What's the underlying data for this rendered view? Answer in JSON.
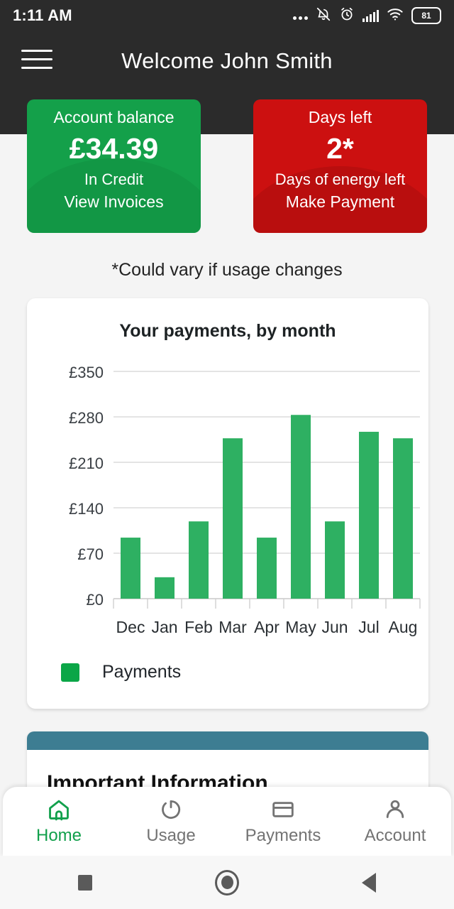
{
  "status_bar": {
    "time": "1:11 AM",
    "battery": "81",
    "icons": [
      "more-dots-icon",
      "bell-muted-icon",
      "alarm-icon",
      "signal-icon",
      "wifi-icon",
      "battery-icon"
    ]
  },
  "app_bar": {
    "title": "Welcome John Smith",
    "menu_icon": "hamburger-icon"
  },
  "summary": {
    "balance_card": {
      "title": "Account balance",
      "amount": "£34.39",
      "status": "In Credit",
      "action": "View Invoices",
      "color": "#14a04a"
    },
    "days_card": {
      "title": "Days left",
      "amount": "2*",
      "status": "Days of energy left",
      "action": "Make Payment",
      "color": "#cc1010"
    },
    "footnote": "*Could vary if usage changes"
  },
  "chart_data": {
    "type": "bar",
    "title": "Your payments, by month",
    "categories": [
      "Dec",
      "Jan",
      "Feb",
      "Mar",
      "Apr",
      "May",
      "Jun",
      "Jul",
      "Aug"
    ],
    "values": [
      94,
      33,
      119,
      247,
      94,
      283,
      119,
      257,
      247
    ],
    "series": [
      {
        "name": "Payments",
        "values": [
          94,
          33,
          119,
          247,
          94,
          283,
          119,
          257,
          247
        ],
        "color": "#2eb062"
      }
    ],
    "ytick_labels": [
      "£0",
      "£70",
      "£140",
      "£210",
      "£280",
      "£350"
    ],
    "yticks": [
      0,
      70,
      140,
      210,
      280,
      350
    ],
    "ylim": [
      0,
      350
    ],
    "xlabel": "",
    "ylabel": "",
    "grid": true,
    "legend": [
      {
        "label": "Payments",
        "color": "#0ba647"
      }
    ],
    "legend_position": "bottom-left"
  },
  "info_card": {
    "heading": "Important Information",
    "header_color": "#3d7d92"
  },
  "bottom_nav": {
    "items": [
      {
        "label": "Home",
        "icon": "home-icon",
        "active": true
      },
      {
        "label": "Usage",
        "icon": "gauge-icon",
        "active": false
      },
      {
        "label": "Payments",
        "icon": "credit-card-icon",
        "active": false
      },
      {
        "label": "Account",
        "icon": "person-icon",
        "active": false
      }
    ],
    "active_color": "#12a04c"
  },
  "system_nav": {
    "recents": "square-icon",
    "home": "circle-icon",
    "back": "triangle-back-icon"
  }
}
